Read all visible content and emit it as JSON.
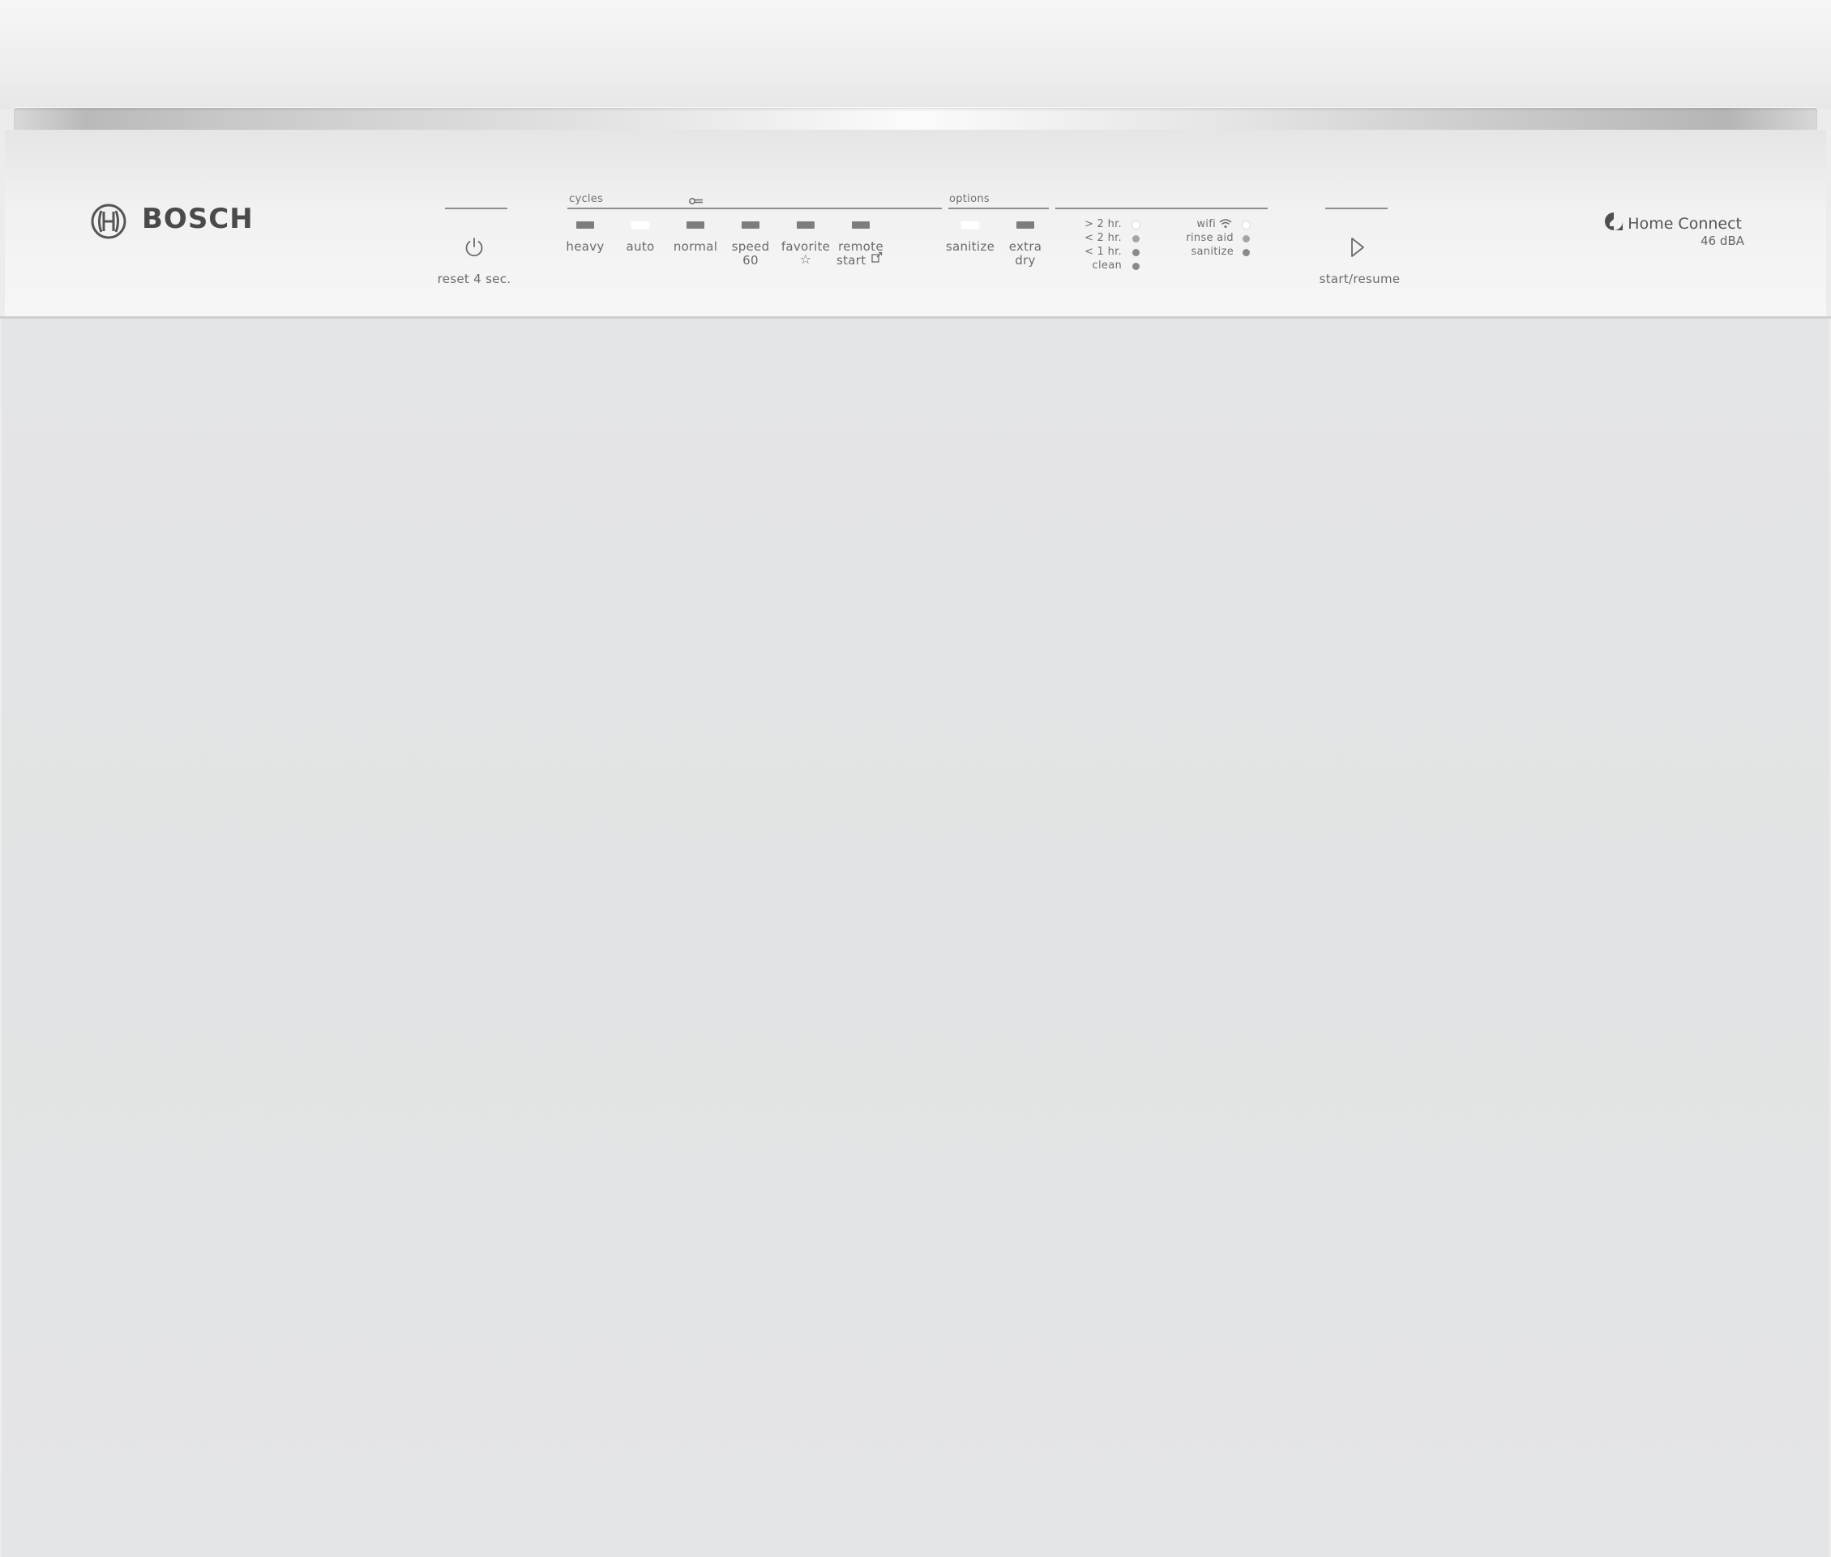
{
  "brand": {
    "name": "BOSCH",
    "logo_icon": "bosch-armature-icon"
  },
  "power": {
    "icon": "power-icon",
    "label": "reset 4 sec."
  },
  "cycles": {
    "header": "cycles",
    "lock_icon": "key-lock-icon",
    "items": [
      {
        "label": "heavy",
        "active": false
      },
      {
        "label": "auto",
        "active": true
      },
      {
        "label": "normal",
        "active": false
      },
      {
        "label": "speed",
        "label2": "60",
        "active": false
      },
      {
        "label": "favorite",
        "icon": "star-icon",
        "glyph": "☆",
        "active": false
      },
      {
        "label": "remote",
        "label2": "start",
        "icon": "remote-start-icon",
        "active": false
      }
    ]
  },
  "options": {
    "header": "options",
    "items": [
      {
        "label": "sanitize",
        "active": true
      },
      {
        "label": "extra",
        "label2": "dry",
        "active": false
      }
    ]
  },
  "time_indicators": [
    {
      "label": "> 2 hr.",
      "state": "on"
    },
    {
      "label": "< 2 hr.",
      "state": "mid"
    },
    {
      "label": "< 1 hr.",
      "state": "off"
    },
    {
      "label": "clean",
      "state": "off"
    }
  ],
  "status_indicators": [
    {
      "label": "wifi",
      "icon": "wifi-icon",
      "state": "on"
    },
    {
      "label": "rinse aid",
      "state": "mid"
    },
    {
      "label": "sanitize",
      "state": "off"
    }
  ],
  "start": {
    "icon": "play-icon",
    "label": "start/resume"
  },
  "home_connect": {
    "name": "Home Connect",
    "icon": "home-connect-icon",
    "noise": "46 dBA"
  },
  "colors": {
    "led_on": "#ffffff",
    "led_off": "#7d7d7d",
    "text": "#6b6b6b"
  }
}
